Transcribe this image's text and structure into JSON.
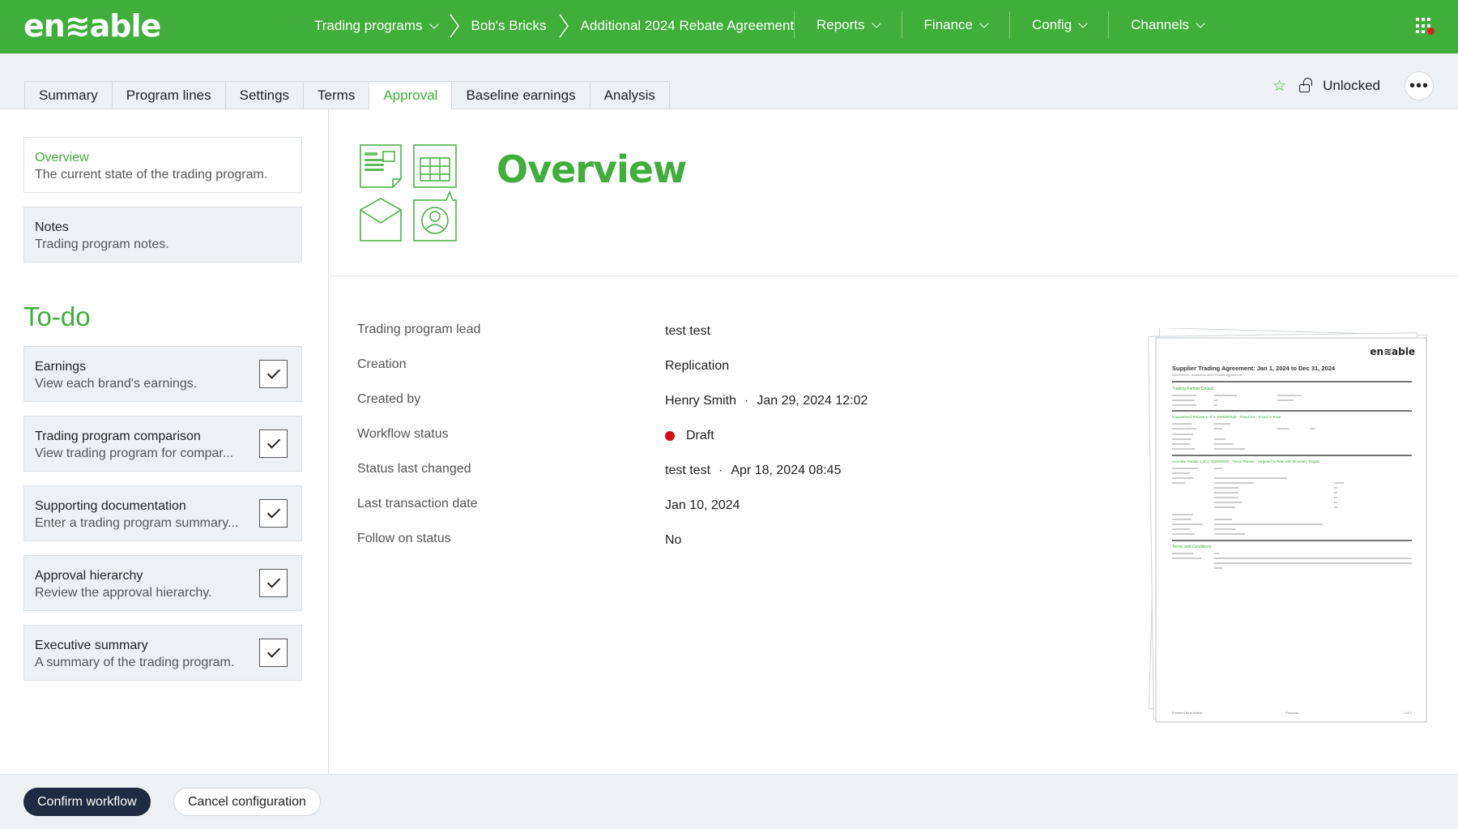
{
  "brand": {
    "logo_text": "en≋able",
    "accent": "#3fae3a",
    "dark": "#1e2b40"
  },
  "breadcrumb": [
    {
      "label": "Trading programs",
      "dropdown": true
    },
    {
      "label": "Bob's Bricks"
    },
    {
      "label": "Additional 2024 Rebate Agreement"
    }
  ],
  "nav": [
    "Reports",
    "Finance",
    "Config",
    "Channels"
  ],
  "tabs": [
    "Summary",
    "Program lines",
    "Settings",
    "Terms",
    "Approval",
    "Baseline earnings",
    "Analysis"
  ],
  "active_tab": "Approval",
  "tools": {
    "lock_label": "Unlocked",
    "more_icon": "ellipsis-icon",
    "star_icon": "star-icon"
  },
  "sidebar": {
    "cards": [
      {
        "title": "Overview",
        "desc": "The current state of the trading program."
      },
      {
        "title": "Notes",
        "desc": "Trading program notes."
      }
    ],
    "todo_heading": "To-do",
    "todo": [
      {
        "title": "Earnings",
        "desc": "View each brand's earnings.",
        "checked": true
      },
      {
        "title": "Trading program comparison",
        "desc": "View trading program for compar...",
        "checked": true
      },
      {
        "title": "Supporting documentation",
        "desc": "Enter a trading program summary...",
        "checked": true
      },
      {
        "title": "Approval hierarchy",
        "desc": "Review the approval hierarchy.",
        "checked": true
      },
      {
        "title": "Executive summary",
        "desc": "A summary of the trading program.",
        "checked": true
      }
    ]
  },
  "overview": {
    "title": "Overview",
    "fields": [
      {
        "label": "Trading program lead",
        "value": "test test"
      },
      {
        "label": "Creation",
        "value": "Replication"
      },
      {
        "label": "Created by",
        "value": "Henry Smith",
        "extra": "Jan 29, 2024 12:02"
      },
      {
        "label": "Workflow status",
        "value": "Draft",
        "status_color": "#d60e0e"
      },
      {
        "label": "Status last changed",
        "value": "test test",
        "extra": "Apr 18, 2024 08:45"
      },
      {
        "label": "Last transaction date",
        "value": "Jan 10, 2024"
      },
      {
        "label": "Follow on status",
        "value": "No"
      }
    ]
  },
  "document": {
    "logo": "en≋able",
    "title": "Supplier Trading Agreement: Jan 1, 2024 to Dec 31, 2024",
    "subtitle": "D00000026 - Additional 2024 Rebate Agreement",
    "sec1": "Trading Partner Details",
    "sec2": "Guaranteed Rebate 1 of 1: D00000049 - Fixed 2% - Fixed % Rate",
    "sec3": "Incentive Rebate 1 of 1: D00000050 - Tiered Rebate - Targeted % Rate with Monetary Targets",
    "sec4": "Terms and Conditions",
    "footer_left": "Powered by en≋able",
    "footer_mid": "Proposal",
    "footer_right": "1 of 1"
  },
  "footer": {
    "confirm": "Confirm workflow",
    "cancel": "Cancel configuration"
  }
}
